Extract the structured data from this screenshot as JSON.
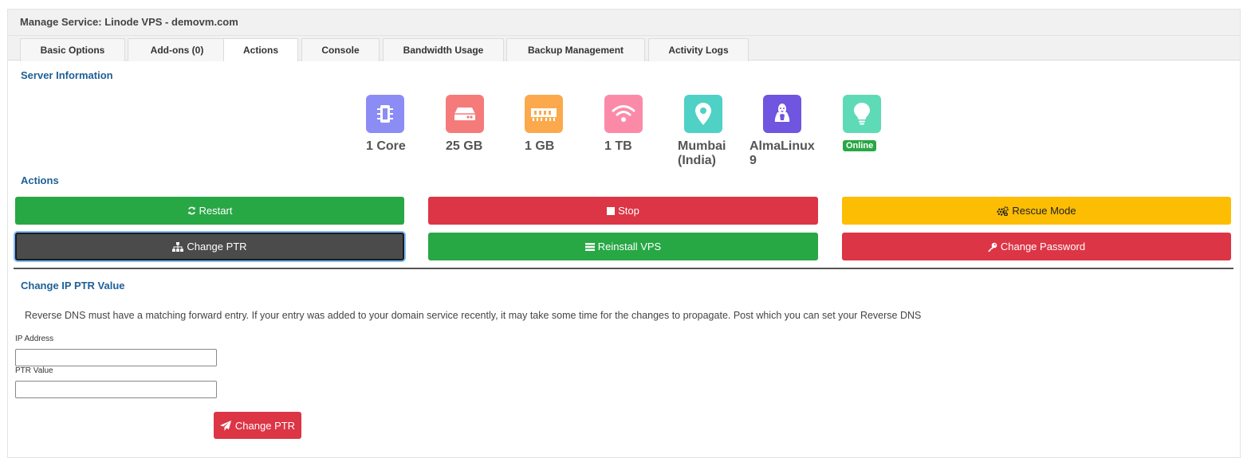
{
  "panel": {
    "title": "Manage Service: Linode VPS - demovm.com"
  },
  "tabs": [
    {
      "label": "Basic Options"
    },
    {
      "label": "Add-ons (0)"
    },
    {
      "label": "Actions"
    },
    {
      "label": "Console"
    },
    {
      "label": "Bandwidth Usage"
    },
    {
      "label": "Backup Management"
    },
    {
      "label": "Activity Logs"
    }
  ],
  "active_tab": "Actions",
  "server_info": {
    "title": "Server Information",
    "stats": [
      {
        "icon": "cpu-icon",
        "value": "1 Core",
        "color": "#8c8cf5"
      },
      {
        "icon": "storage-icon",
        "value": "25 GB",
        "color": "#f57a7a"
      },
      {
        "icon": "memory-icon",
        "value": "1 GB",
        "color": "#fba94c"
      },
      {
        "icon": "bandwidth-icon",
        "value": "1 TB",
        "color": "#fb8aa9"
      },
      {
        "icon": "location-icon",
        "value": "Mumbai\n(India)",
        "color": "#4fd1c5"
      },
      {
        "icon": "linux-icon",
        "value": "AlmaLinux\n9",
        "color": "#6f55e0"
      },
      {
        "icon": "status-icon",
        "value": "Online",
        "color": "#5fdab6"
      }
    ]
  },
  "actions": {
    "title": "Actions",
    "buttons": [
      {
        "label": "Restart",
        "icon": "refresh-icon",
        "color": "#28a745"
      },
      {
        "label": "Stop",
        "icon": "stop-icon",
        "color": "#dc3545"
      },
      {
        "label": "Rescue Mode",
        "icon": "gears-icon",
        "color": "#fdbd03"
      },
      {
        "label": "Change PTR",
        "icon": "sitemap-icon",
        "color": "#4b4b4b"
      },
      {
        "label": "Reinstall VPS",
        "icon": "list-icon",
        "color": "#28a745"
      },
      {
        "label": "Change Password",
        "icon": "key-icon",
        "color": "#dc3545"
      }
    ]
  },
  "ptr": {
    "title": "Change IP PTR Value",
    "description": "Reverse DNS must have a matching forward entry. If your entry was added to your domain service recently, it may take some time for the changes to propagate. Post which you can set your Reverse DNS",
    "ip_label": "IP Address",
    "ip_value": "",
    "ptr_label": "PTR Value",
    "ptr_value": "",
    "submit_label": "Change PTR"
  }
}
